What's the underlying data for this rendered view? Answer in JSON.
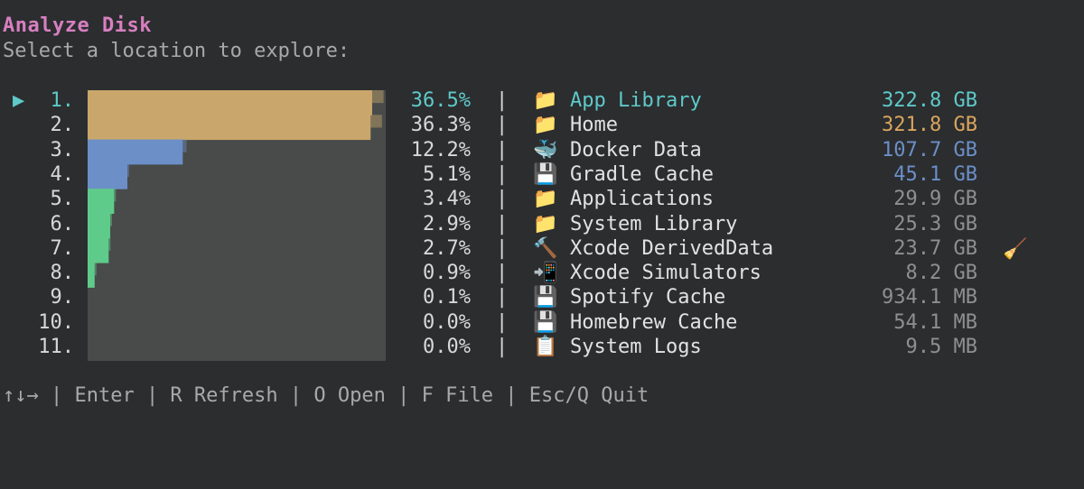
{
  "header": {
    "title": "Analyze Disk",
    "subtitle": "Select a location to explore:"
  },
  "cursor_glyph": "▶",
  "separator": "|",
  "colors": {
    "selected": "#5fc9c9",
    "large": "#d9a55d",
    "medium": "#6c8fc8",
    "normal": "#8f8f8f",
    "bar_gold": "#c9a66b",
    "bar_blue": "#6c8fc8",
    "bar_green": "#5fcb8a",
    "bar_track": "#484b4a"
  },
  "entries": [
    {
      "index": "1.",
      "percent": "36.5%",
      "icon": "folder-icon",
      "glyph": "📁",
      "name": "App Library",
      "size": "322.8 GB",
      "size_tier": "selected",
      "share": 0.365,
      "selected": true
    },
    {
      "index": "2.",
      "percent": "36.3%",
      "icon": "folder-icon",
      "glyph": "📁",
      "name": "Home",
      "size": "321.8 GB",
      "size_tier": "large",
      "share": 0.363,
      "selected": false
    },
    {
      "index": "3.",
      "percent": "12.2%",
      "icon": "whale-icon",
      "glyph": "🐳",
      "name": "Docker Data",
      "size": "107.7 GB",
      "size_tier": "medium",
      "share": 0.122,
      "selected": false
    },
    {
      "index": "4.",
      "percent": "5.1%",
      "icon": "floppy-disk-icon",
      "glyph": "💾",
      "name": "Gradle Cache",
      "size": "45.1 GB",
      "size_tier": "medium",
      "share": 0.051,
      "selected": false
    },
    {
      "index": "5.",
      "percent": "3.4%",
      "icon": "folder-icon",
      "glyph": "📁",
      "name": "Applications",
      "size": "29.9 GB",
      "size_tier": "normal",
      "share": 0.034,
      "selected": false
    },
    {
      "index": "6.",
      "percent": "2.9%",
      "icon": "folder-icon",
      "glyph": "📁",
      "name": "System Library",
      "size": "25.3 GB",
      "size_tier": "normal",
      "share": 0.029,
      "selected": false
    },
    {
      "index": "7.",
      "percent": "2.7%",
      "icon": "hammer-icon",
      "glyph": "🔨",
      "name": "Xcode DerivedData",
      "size": "23.7 GB",
      "size_tier": "normal",
      "share": 0.027,
      "selected": false
    },
    {
      "index": "8.",
      "percent": "0.9%",
      "icon": "phone-arrow-icon",
      "glyph": "📲",
      "name": "Xcode Simulators",
      "size": "8.2 GB",
      "size_tier": "normal",
      "share": 0.009,
      "selected": false
    },
    {
      "index": "9.",
      "percent": "0.1%",
      "icon": "floppy-disk-icon",
      "glyph": "💾",
      "name": "Spotify Cache",
      "size": "934.1 MB",
      "size_tier": "normal",
      "share": 0.001,
      "selected": false
    },
    {
      "index": "10.",
      "percent": "0.0%",
      "icon": "floppy-disk-icon",
      "glyph": "💾",
      "name": "Homebrew Cache",
      "size": "54.1 MB",
      "size_tier": "normal",
      "share": 0.0,
      "selected": false
    },
    {
      "index": "11.",
      "percent": "0.0%",
      "icon": "clipboard-icon",
      "glyph": "📋",
      "name": "System Logs",
      "size": "9.5 MB",
      "size_tier": "normal",
      "share": 0.0,
      "selected": false
    }
  ],
  "cleanable_icon": {
    "name": "broom-icon",
    "glyph": "🧹"
  },
  "footer": "↑↓→ | Enter | R Refresh | O Open | F File | Esc/Q Quit"
}
